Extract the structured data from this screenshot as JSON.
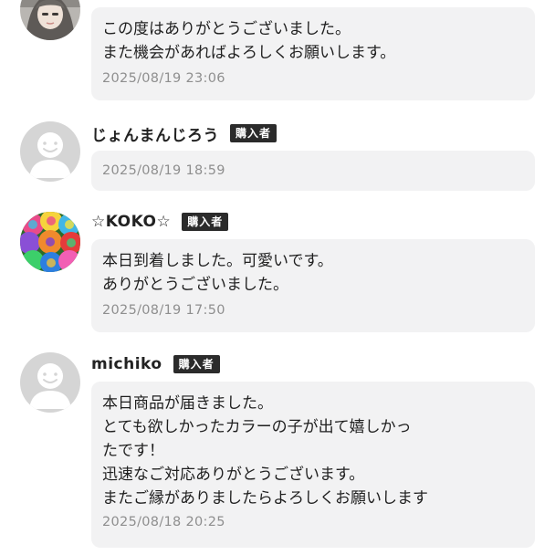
{
  "reviews": [
    {
      "avatar": "photo-avatar",
      "lines": [
        "この度はありがとうございました。",
        "また機会があればよろしくお願いします。"
      ],
      "date": "2025/08/19 23:06"
    },
    {
      "name": "じょんまんじろう",
      "badge": "購入者",
      "avatar": "default-avatar",
      "lines": [],
      "date": "2025/08/19 18:59"
    },
    {
      "name": "☆KOKO☆",
      "badge": "購入者",
      "avatar": "rainbow-roses-avatar",
      "lines": [
        "本日到着しました。可愛いです。",
        "ありがとうございました。"
      ],
      "date": "2025/08/19 17:50"
    },
    {
      "name": "michiko",
      "badge": "購入者",
      "avatar": "default-avatar",
      "lines": [
        "本日商品が届きました。",
        "とても欲しかったカラーの子が出て嬉しかっ",
        "たです！",
        "迅速なご対応ありがとうございます。",
        "またご縁がありましたらよろしくお願いします"
      ],
      "date": "2025/08/18 20:25"
    }
  ],
  "colors": {
    "bubble": "#f2f2f3",
    "badge": "#2b2b2b",
    "date": "#8f8f8f",
    "default_avatar": "#d5d5d5"
  }
}
